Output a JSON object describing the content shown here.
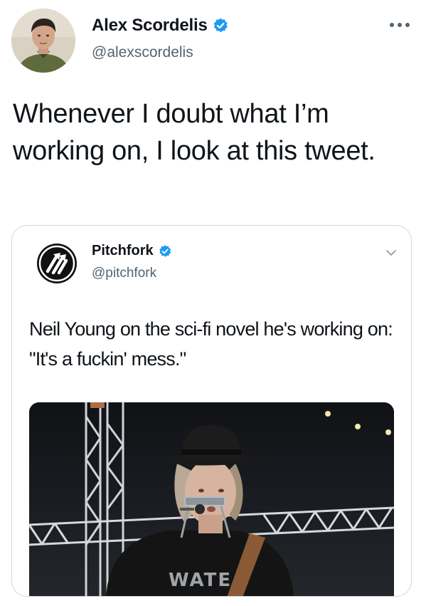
{
  "author": {
    "name": "Alex Scordelis",
    "handle": "@alexscordelis",
    "verified": true,
    "avatar_icon": "profile-photo"
  },
  "tweet": {
    "text": "Whenever I doubt what I’m working on, I look at this tweet."
  },
  "more_icon": "ellipsis-icon",
  "quoted": {
    "name": "Pitchfork",
    "handle": "@pitchfork",
    "verified": true,
    "logo_icon": "pitchfork-logo",
    "text": "Neil Young on the sci-fi novel he's working on: \"It's a fuckin' mess.\"",
    "media_icon": "photo-neil-young-on-stage",
    "shirt_text": "WATE"
  },
  "colors": {
    "verified_blue": "#1d9bf0",
    "secondary_text": "#536471",
    "border": "#cfd9de"
  }
}
